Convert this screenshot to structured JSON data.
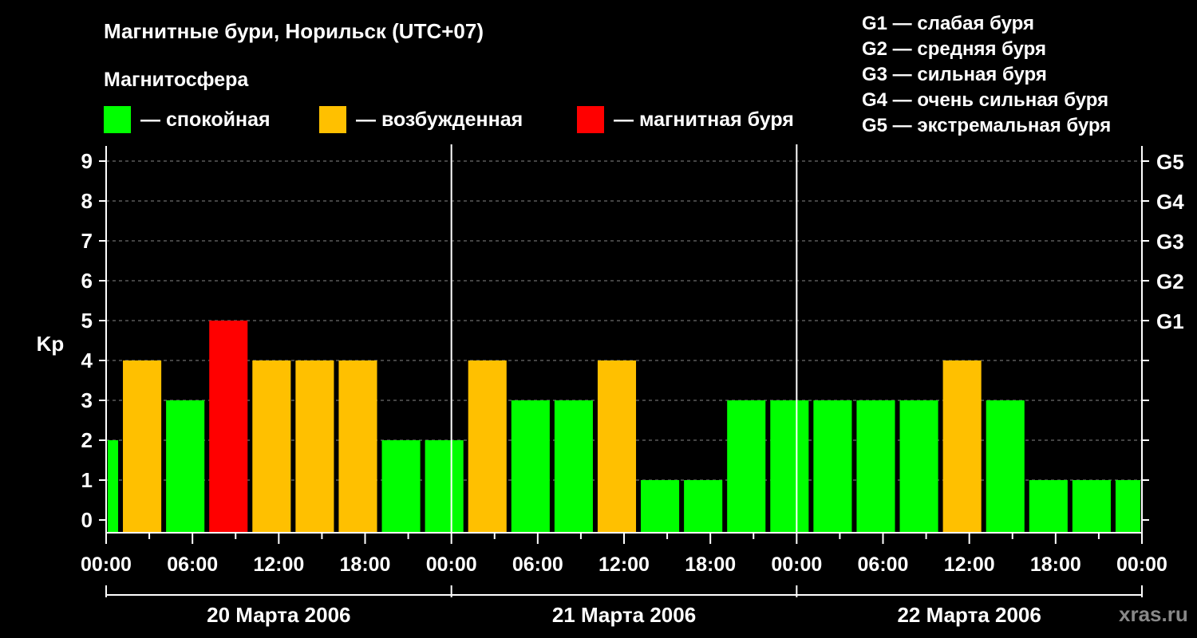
{
  "chart_data": {
    "type": "bar",
    "title": "Магнитные бури, Норильск (UTC+07)",
    "subtitle": "Магнитосфера",
    "ylabel": "Kp",
    "ylim": [
      0,
      9
    ],
    "yticks": [
      "0",
      "1",
      "2",
      "3",
      "4",
      "5",
      "6",
      "7",
      "8",
      "9"
    ],
    "right_ticks": [
      {
        "kp": 5,
        "label": "G1"
      },
      {
        "kp": 6,
        "label": "G2"
      },
      {
        "kp": 7,
        "label": "G3"
      },
      {
        "kp": 8,
        "label": "G4"
      },
      {
        "kp": 9,
        "label": "G5"
      }
    ],
    "legend": [
      {
        "label": "— спокойная",
        "color": "#00ff00"
      },
      {
        "label": "— возбужденная",
        "color": "#ffc000"
      },
      {
        "label": "— магнитная буря",
        "color": "#ff0000"
      }
    ],
    "g_scale": [
      "G1 — слабая буря",
      "G2 — средняя буря",
      "G3 — сильная буря",
      "G4 — очень сильная буря",
      "G5 — экстремальная буря"
    ],
    "x_tick_labels": [
      "00:00",
      "06:00",
      "12:00",
      "18:00",
      "00:00",
      "06:00",
      "12:00",
      "18:00",
      "00:00",
      "06:00",
      "12:00",
      "18:00",
      "00:00"
    ],
    "days": [
      "20 Марта 2006",
      "21 Марта 2006",
      "22 Марта 2006"
    ],
    "x_range_hours": [
      0,
      72
    ],
    "grid": "dashed horizontal at Kp 1–9",
    "bars": [
      {
        "start_hour": 0,
        "end_hour": 1,
        "kp": 2,
        "status": "спокойная"
      },
      {
        "start_hour": 1,
        "end_hour": 4,
        "kp": 4,
        "status": "возбужденная"
      },
      {
        "start_hour": 4,
        "end_hour": 7,
        "kp": 3,
        "status": "спокойная"
      },
      {
        "start_hour": 7,
        "end_hour": 10,
        "kp": 5,
        "status": "магнитная буря"
      },
      {
        "start_hour": 10,
        "end_hour": 13,
        "kp": 4,
        "status": "возбужденная"
      },
      {
        "start_hour": 13,
        "end_hour": 16,
        "kp": 4,
        "status": "возбужденная"
      },
      {
        "start_hour": 16,
        "end_hour": 19,
        "kp": 4,
        "status": "возбужденная"
      },
      {
        "start_hour": 19,
        "end_hour": 22,
        "kp": 2,
        "status": "спокойная"
      },
      {
        "start_hour": 22,
        "end_hour": 25,
        "kp": 2,
        "status": "спокойная"
      },
      {
        "start_hour": 25,
        "end_hour": 28,
        "kp": 4,
        "status": "возбужденная"
      },
      {
        "start_hour": 28,
        "end_hour": 31,
        "kp": 3,
        "status": "спокойная"
      },
      {
        "start_hour": 31,
        "end_hour": 34,
        "kp": 3,
        "status": "спокойная"
      },
      {
        "start_hour": 34,
        "end_hour": 37,
        "kp": 4,
        "status": "возбужденная"
      },
      {
        "start_hour": 37,
        "end_hour": 40,
        "kp": 1,
        "status": "спокойная"
      },
      {
        "start_hour": 40,
        "end_hour": 43,
        "kp": 1,
        "status": "спокойная"
      },
      {
        "start_hour": 43,
        "end_hour": 46,
        "kp": 3,
        "status": "спокойная"
      },
      {
        "start_hour": 46,
        "end_hour": 49,
        "kp": 3,
        "status": "спокойная"
      },
      {
        "start_hour": 49,
        "end_hour": 52,
        "kp": 3,
        "status": "спокойная"
      },
      {
        "start_hour": 52,
        "end_hour": 55,
        "kp": 3,
        "status": "спокойная"
      },
      {
        "start_hour": 55,
        "end_hour": 58,
        "kp": 3,
        "status": "спокойная"
      },
      {
        "start_hour": 58,
        "end_hour": 61,
        "kp": 4,
        "status": "возбужденная"
      },
      {
        "start_hour": 61,
        "end_hour": 64,
        "kp": 3,
        "status": "спокойная"
      },
      {
        "start_hour": 64,
        "end_hour": 67,
        "kp": 1,
        "status": "спокойная"
      },
      {
        "start_hour": 67,
        "end_hour": 70,
        "kp": 1,
        "status": "спокойная"
      },
      {
        "start_hour": 70,
        "end_hour": 72,
        "kp": 1,
        "status": "спокойная"
      }
    ],
    "status_colors": {
      "спокойная": "#00ff00",
      "возбужденная": "#ffc000",
      "магнитная буря": "#ff0000"
    }
  },
  "watermark": "xras.ru"
}
